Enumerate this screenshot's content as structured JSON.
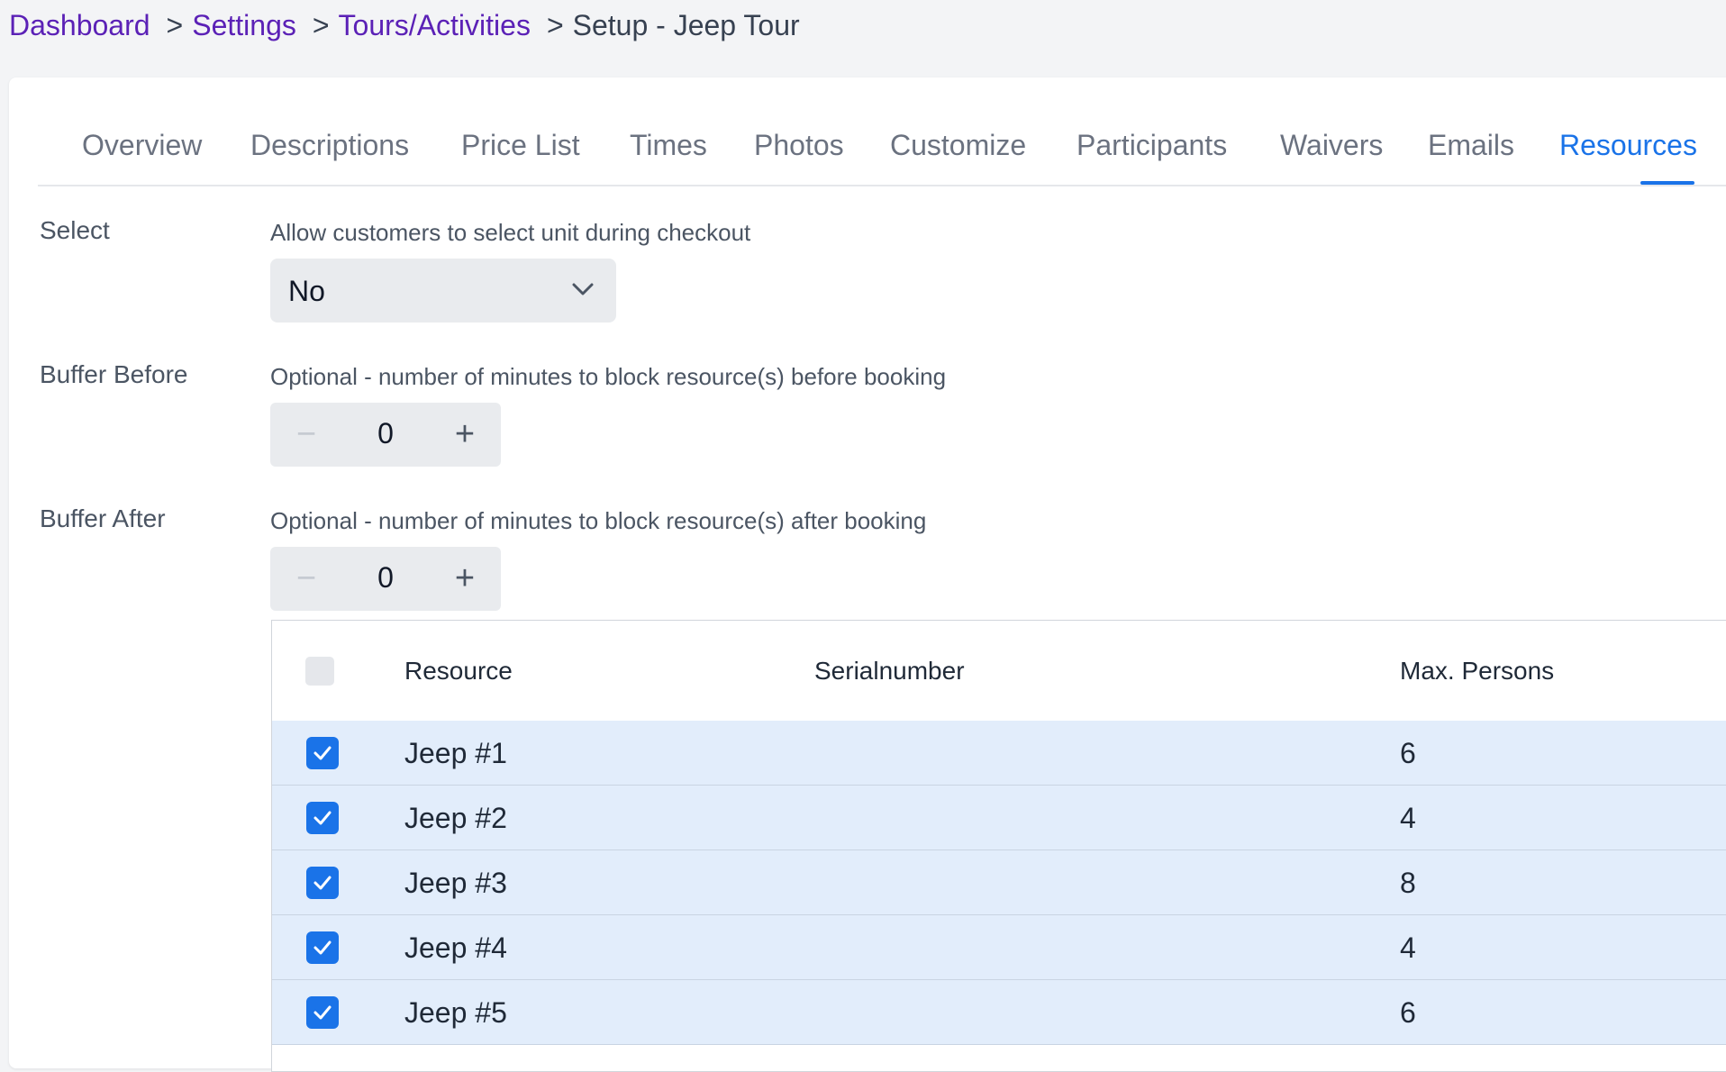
{
  "breadcrumb": {
    "items": [
      "Dashboard",
      "Settings",
      "Tours/Activities"
    ],
    "current": "Setup - Jeep Tour",
    "separator": ">"
  },
  "tabs": {
    "items": [
      "Overview",
      "Descriptions",
      "Price List",
      "Times",
      "Photos",
      "Customize",
      "Participants",
      "Waivers",
      "Emails",
      "Resources"
    ],
    "active": "Resources"
  },
  "form": {
    "select": {
      "label": "Select",
      "help": "Allow customers to select unit during checkout",
      "value": "No"
    },
    "buffer_before": {
      "label": "Buffer Before",
      "help": "Optional - number of minutes to block resource(s) before booking",
      "value": "0",
      "minus": "−",
      "plus": "+"
    },
    "buffer_after": {
      "label": "Buffer After",
      "help": "Optional - number of minutes to block resource(s) after booking",
      "value": "0",
      "minus": "−",
      "plus": "+"
    }
  },
  "table": {
    "headers": {
      "resource": "Resource",
      "serial": "Serialnumber",
      "max_persons": "Max. Persons"
    },
    "rows": [
      {
        "resource": "Jeep #1",
        "serial": "",
        "max_persons": "6",
        "checked": true
      },
      {
        "resource": "Jeep #2",
        "serial": "",
        "max_persons": "4",
        "checked": true
      },
      {
        "resource": "Jeep #3",
        "serial": "",
        "max_persons": "8",
        "checked": true
      },
      {
        "resource": "Jeep #4",
        "serial": "",
        "max_persons": "4",
        "checked": true
      },
      {
        "resource": "Jeep #5",
        "serial": "",
        "max_persons": "6",
        "checked": true
      }
    ]
  },
  "colors": {
    "accent": "#1a73e8",
    "link": "#5b21b6",
    "row_selected": "#e2edfb",
    "page_bg": "#f3f4f6"
  }
}
